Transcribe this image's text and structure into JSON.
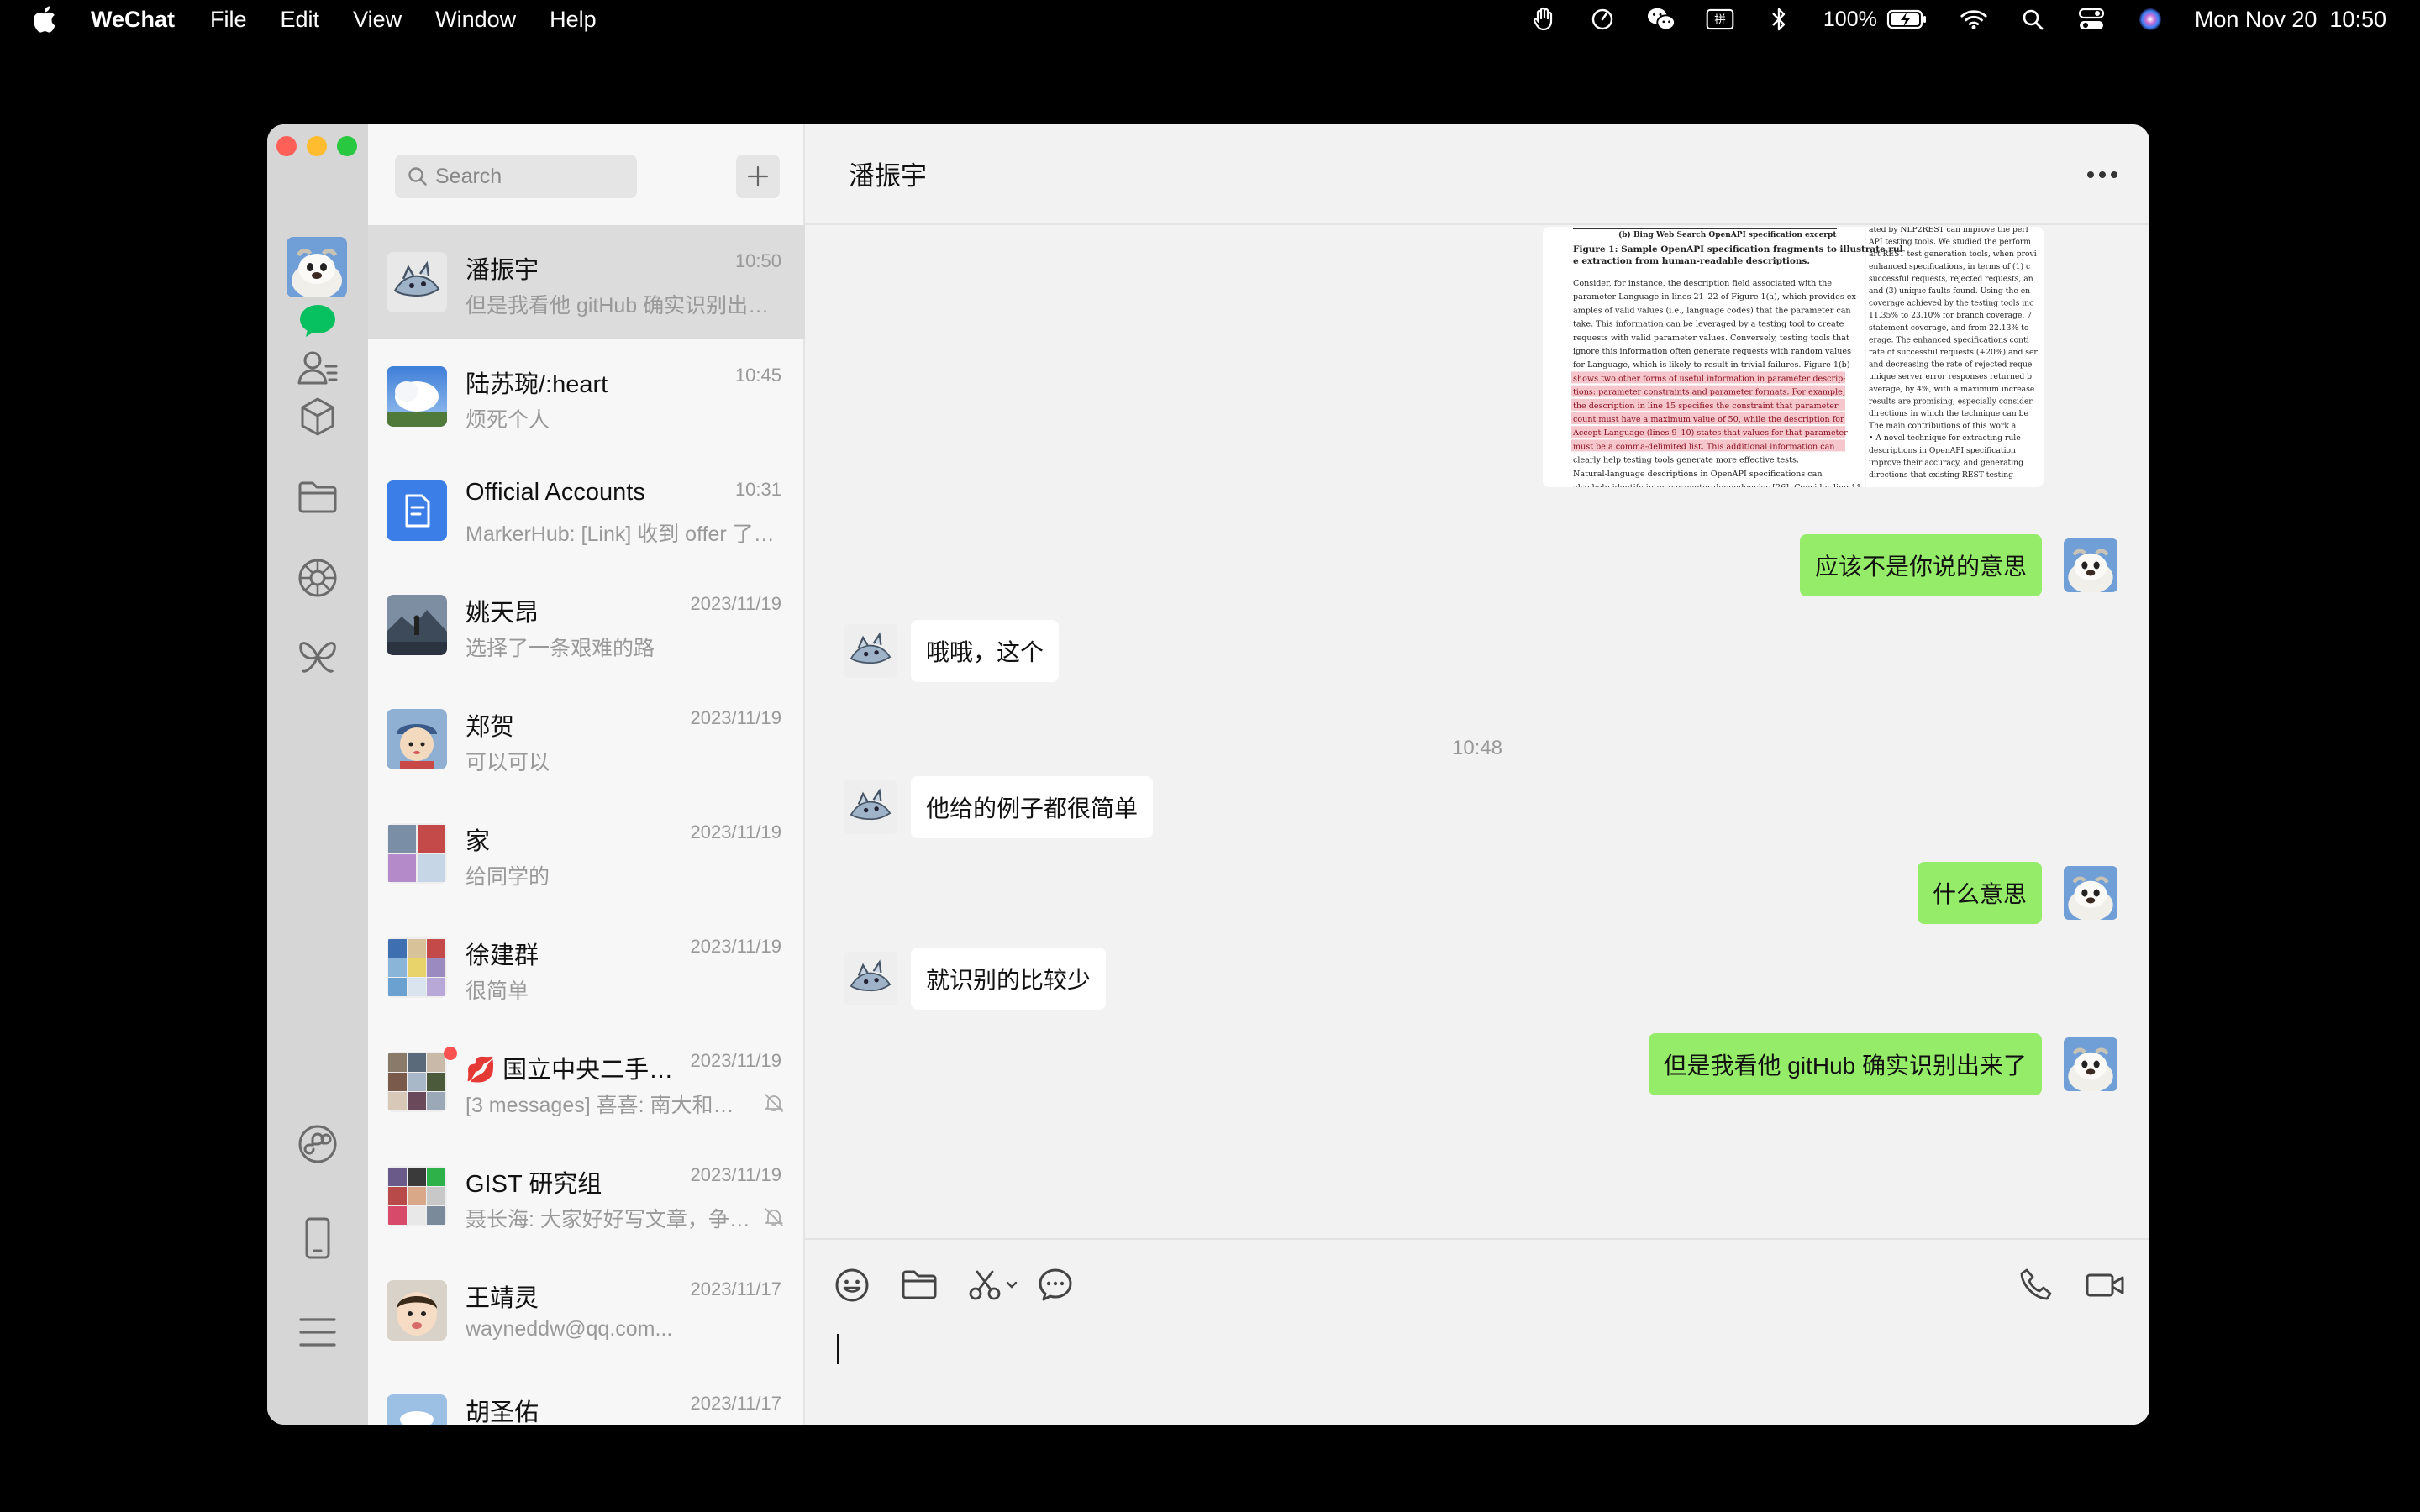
{
  "menubar": {
    "app_name": "WeChat",
    "menus": [
      "File",
      "Edit",
      "View",
      "Window",
      "Help"
    ],
    "battery": "100%",
    "datetime": "Mon Nov 20  10:50"
  },
  "search": {
    "placeholder": "Search"
  },
  "chats": [
    {
      "name": "潘振宇",
      "time": "10:50",
      "preview": "但是我看他 gitHub 确实识别出来了"
    },
    {
      "name": "陆苏琬/:heart",
      "time": "10:45",
      "preview": "烦死个人"
    },
    {
      "name": "Official Accounts",
      "time": "10:31",
      "preview": "MarkerHub: [Link] 收到 offer 了…"
    },
    {
      "name": "姚天昂",
      "time": "2023/11/19",
      "preview": "选择了一条艰难的路"
    },
    {
      "name": "郑贺",
      "time": "2023/11/19",
      "preview": "可以可以"
    },
    {
      "name": "家",
      "time": "2023/11/19",
      "preview": "给同学的"
    },
    {
      "name": "徐建群",
      "time": "2023/11/19",
      "preview": "很简单"
    },
    {
      "name": "💋 国立中央二手…",
      "time": "2023/11/19",
      "preview": "[3 messages] 喜喜: 南大和园…"
    },
    {
      "name": "GIST 研究组",
      "time": "2023/11/19",
      "preview": "聂长海: 大家好好写文章，争…"
    },
    {
      "name": "王靖灵",
      "time": "2023/11/17",
      "preview": "wayneddw@qq.com..."
    },
    {
      "name": "胡圣佑",
      "time": "2023/11/17",
      "preview": ""
    }
  ],
  "conversation": {
    "title": "潘振宇",
    "paper": {
      "caption_b": "(b) Bing Web Search OpenAPI specification excerpt",
      "figure_title": "Figure 1: Sample OpenAPI specification fragments to illustrate rule extraction from human-readable descriptions.",
      "body_lines": [
        "Consider, for instance, the description field associated with the",
        "parameter Language in lines 21–22 of Figure 1(a), which provides ex-",
        "amples of valid values (i.e., language codes) that the parameter can",
        "take. This information can be leveraged by a testing tool to create",
        "requests with valid parameter values. Conversely, testing tools that",
        "ignore this information often generate requests with random values",
        "for Language, which is likely to result in trivial failures. Figure 1(b)",
        "shows two other forms of useful information in parameter descrip-",
        "tions: parameter constraints and parameter formats. For example,",
        "the description in line 15 specifies the constraint that parameter",
        "count must have a maximum value of 50, while the description for",
        "Accept-Language (lines 9–10) states that values for that parameter",
        "must be a comma-delimited list. This additional information can",
        "clearly help testing tools generate more effective tests.",
        "Natural-language descriptions in OpenAPI specifications can",
        "also help identify inter-parameter dependencies [26]. Consider line 11"
      ],
      "right_lines": [
        "ated by NLP2REST can improve the perf",
        "API testing tools. We studied the perform",
        "art REST test generation tools, when provi",
        "enhanced specifications, in terms of (1) c",
        "successful requests, rejected requests, an",
        "and (3) unique faults found. Using the en",
        "coverage achieved by the testing tools inc",
        "11.35% to 23.10% for branch coverage, 7",
        "statement coverage, and from 22.13% to",
        "erage. The enhanced specifications conti",
        "rate of successful requests (+20%) and ser",
        "and decreasing the rate of rejected reque",
        "unique server error responses returned b",
        "average, by 4%, with a maximum increase",
        "results are promising, especially consider",
        "directions in which the technique can be",
        "The main contributions of this work a",
        "• A novel technique for extracting rule",
        "descriptions in OpenAPI specification",
        "improve their accuracy, and generating",
        "directions that existing REST testing"
      ]
    },
    "messages": [
      {
        "dir": "out",
        "text": "应该不是你说的意思"
      },
      {
        "dir": "in",
        "text": "哦哦，这个"
      },
      {
        "dir": "time",
        "text": "10:48"
      },
      {
        "dir": "in",
        "text": "他给的例子都很简单"
      },
      {
        "dir": "out",
        "text": "什么意思"
      },
      {
        "dir": "in",
        "text": "就识别的比较少"
      },
      {
        "dir": "out",
        "text": "但是我看他 gitHub 确实识别出来了"
      }
    ]
  },
  "colors": {
    "bubble_out": "#95ec69",
    "bubble_in": "#ffffff",
    "active_chat": "#dcdcdc",
    "wechat_green": "#07c160"
  }
}
